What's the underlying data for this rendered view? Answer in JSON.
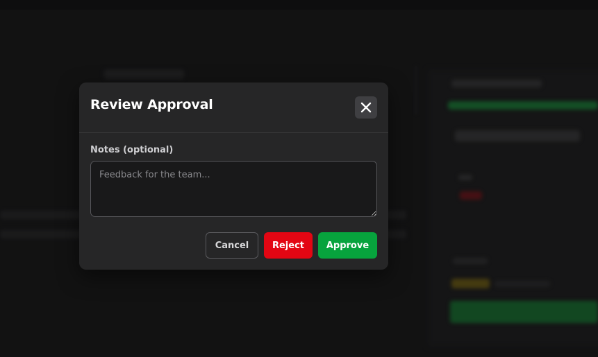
{
  "modal": {
    "title": "Review Approval",
    "close_icon": "close-icon",
    "notes_label": "Notes (optional)",
    "notes_placeholder": "Feedback for the team...",
    "notes_value": "",
    "buttons": {
      "cancel": "Cancel",
      "reject": "Reject",
      "approve": "Approve"
    }
  },
  "colors": {
    "reject": "#e30613",
    "approve": "#07a33d",
    "modal_bg": "#262627",
    "page_bg": "#1c1c1d"
  }
}
